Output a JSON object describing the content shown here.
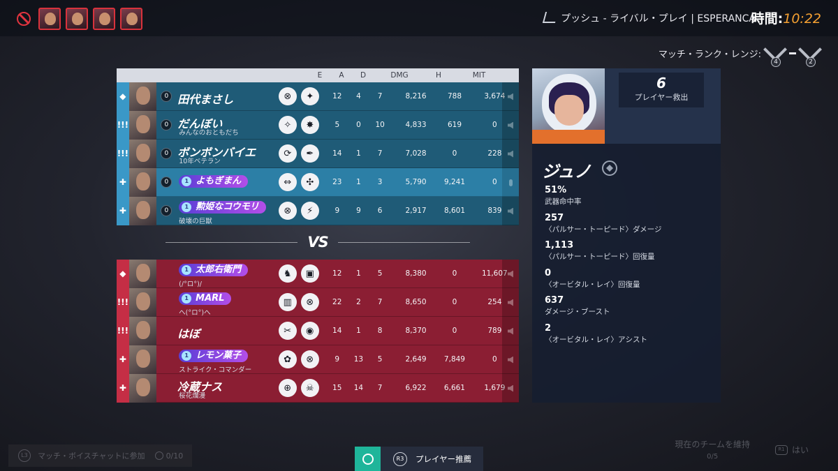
{
  "top": {
    "banned_heroes": [
      "banned-hero-1",
      "banned-hero-2",
      "banned-hero-3",
      "banned-hero-4"
    ],
    "mode": "プッシュ - ライバル・プレイ | ESPERANCA",
    "time_label": "時間:",
    "time_value": "10:22",
    "rank_label": "マッチ・ランク・レンジ:",
    "rank_low": "4",
    "rank_high": "2"
  },
  "headers": {
    "e": "E",
    "a": "A",
    "d": "D",
    "dmg": "DMG",
    "h": "H",
    "mit": "MIT"
  },
  "team_blue": [
    {
      "role": "tank",
      "role_glyph": "◆",
      "level": "0",
      "name": "田代まさし",
      "sub": "",
      "tag": false,
      "perks": [
        "⊗",
        "✦"
      ],
      "e": "12",
      "a": "4",
      "d": "7",
      "dmg": "8,216",
      "h": "788",
      "mit": "3,674"
    },
    {
      "role": "damage",
      "role_glyph": "!!!",
      "level": "0",
      "name": "だんぼい",
      "sub": "みんなのおともだち",
      "tag": false,
      "perks": [
        "✧",
        "✸"
      ],
      "e": "5",
      "a": "0",
      "d": "10",
      "dmg": "4,833",
      "h": "619",
      "mit": "0"
    },
    {
      "role": "damage",
      "role_glyph": "!!!",
      "level": "0",
      "name": "ボンボンバイエ",
      "sub": "10年ベテラン",
      "tag": false,
      "perks": [
        "⟳",
        "✒"
      ],
      "e": "14",
      "a": "1",
      "d": "7",
      "dmg": "7,028",
      "h": "0",
      "mit": "228"
    },
    {
      "role": "support",
      "role_glyph": "✚",
      "level": "0",
      "name": "よもぎまん",
      "sub": "",
      "tag": true,
      "self": true,
      "perks": [
        "⇔",
        "✣"
      ],
      "e": "23",
      "a": "1",
      "d": "3",
      "dmg": "5,790",
      "h": "9,241",
      "mit": "0"
    },
    {
      "role": "support",
      "role_glyph": "✚",
      "level": "0",
      "name": "勲姫なコウモリ",
      "sub": "破壊の巨獣",
      "tag": true,
      "perks": [
        "⊗",
        "⚡"
      ],
      "e": "9",
      "a": "9",
      "d": "6",
      "dmg": "2,917",
      "h": "8,601",
      "mit": "839"
    }
  ],
  "vs_label": "VS",
  "team_red": [
    {
      "role": "tank",
      "role_glyph": "◆",
      "name": "太郎右衛門",
      "sub": "(/°ロ°)/",
      "tag": true,
      "perks": [
        "♞",
        "▣"
      ],
      "e": "12",
      "a": "1",
      "d": "5",
      "dmg": "8,380",
      "h": "0",
      "mit": "11,607"
    },
    {
      "role": "damage",
      "role_glyph": "!!!",
      "name": "MARL",
      "sub": "へ(°ロ°)へ",
      "tag": true,
      "perks": [
        "▥",
        "⊗"
      ],
      "e": "22",
      "a": "2",
      "d": "7",
      "dmg": "8,650",
      "h": "0",
      "mit": "254"
    },
    {
      "role": "damage",
      "role_glyph": "!!!",
      "name": "はぼ",
      "sub": "",
      "tag": false,
      "perks": [
        "✂",
        "◉"
      ],
      "e": "14",
      "a": "1",
      "d": "8",
      "dmg": "8,370",
      "h": "0",
      "mit": "789"
    },
    {
      "role": "support",
      "role_glyph": "✚",
      "name": "レモン菓子",
      "sub": "ストライク・コマンダー",
      "tag": true,
      "perks": [
        "✿",
        "⊗"
      ],
      "e": "9",
      "a": "13",
      "d": "5",
      "dmg": "2,649",
      "h": "7,849",
      "mit": "0"
    },
    {
      "role": "support",
      "role_glyph": "✚",
      "name": "冷蔵ナス",
      "sub": "桜花爛漫",
      "tag": false,
      "perks": [
        "⊕",
        "☠"
      ],
      "e": "15",
      "a": "14",
      "d": "7",
      "dmg": "6,922",
      "h": "6,661",
      "mit": "1,679"
    }
  ],
  "side": {
    "rescue_value": "6",
    "rescue_label": "プレイヤー救出",
    "hero_name": "ジュノ",
    "stats": [
      {
        "value": "51%",
        "label": "武器命中率"
      },
      {
        "value": "257",
        "label": "〈パルサー・トーピード〉ダメージ"
      },
      {
        "value": "1,113",
        "label": "〈パルサー・トーピード〉回復量"
      },
      {
        "value": "0",
        "label": "〈オービタル・レイ〉回復量"
      },
      {
        "value": "637",
        "label": "ダメージ・ブースト"
      },
      {
        "value": "2",
        "label": "〈オービタル・レイ〉アシスト"
      }
    ]
  },
  "bottom": {
    "voice_key": "L3",
    "voice_label": "マッチ・ボイスチャットに参加",
    "voice_count": "0/10",
    "endorse_key": "R3",
    "endorse_label": "プレイヤー推薦",
    "keep_team_label": "現在のチームを維持",
    "keep_team_count": "0/5",
    "yes_key": "R1",
    "yes_label": "はい"
  },
  "colors": {
    "blue_row": "#1f5b77",
    "self_row": "#2c7fa6",
    "red_row": "#8b1e33",
    "time_accent": "#f5a032",
    "endorse_accent": "#1fb59a"
  }
}
